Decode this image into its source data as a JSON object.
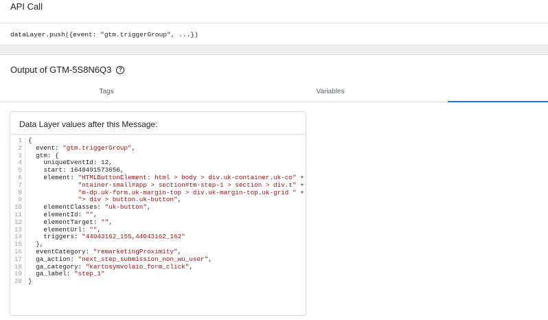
{
  "api_call": {
    "title": "API Call",
    "code": "dataLayer.push({event: \"gtm.triggerGroup\", ...})"
  },
  "output": {
    "title": "Output of GTM-5S8N6Q3",
    "tabs": [
      {
        "label": "Tags"
      },
      {
        "label": "Variables"
      },
      {
        "label": ""
      }
    ],
    "active_tab_index": 2
  },
  "data_layer": {
    "title": "Data Layer values after this Message:",
    "lines": [
      {
        "num": "1",
        "segments": [
          {
            "t": "{",
            "k": "n"
          }
        ]
      },
      {
        "num": "2",
        "segments": [
          {
            "t": "  event: ",
            "k": "n"
          },
          {
            "t": "\"gtm.triggerGroup\"",
            "k": "s"
          },
          {
            "t": ",",
            "k": "n"
          }
        ]
      },
      {
        "num": "3",
        "segments": [
          {
            "t": "  gtm: {",
            "k": "n"
          }
        ]
      },
      {
        "num": "4",
        "segments": [
          {
            "t": "    uniqueEventId: 12,",
            "k": "n"
          }
        ]
      },
      {
        "num": "5",
        "segments": [
          {
            "t": "    start: 1648491573656,",
            "k": "n"
          }
        ]
      },
      {
        "num": "6",
        "segments": [
          {
            "t": "    element: ",
            "k": "n"
          },
          {
            "t": "\"HTMLButtonElement: html > body > div.uk-container.uk-co\"",
            "k": "s"
          },
          {
            "t": " +",
            "k": "n"
          }
        ]
      },
      {
        "num": "7",
        "segments": [
          {
            "t": "             ",
            "k": "n"
          },
          {
            "t": "\"ntainer-small#app > section#tm-step-1 > section > div.t\"",
            "k": "s"
          },
          {
            "t": " +",
            "k": "n"
          }
        ]
      },
      {
        "num": "8",
        "segments": [
          {
            "t": "             ",
            "k": "n"
          },
          {
            "t": "\"m-dp.uk-form.uk-margin-top > div.uk-margin-top.uk-grid \"",
            "k": "s"
          },
          {
            "t": " +",
            "k": "n"
          }
        ]
      },
      {
        "num": "9",
        "segments": [
          {
            "t": "             ",
            "k": "n"
          },
          {
            "t": "\"> div > button.uk-button\"",
            "k": "s"
          },
          {
            "t": ",",
            "k": "n"
          }
        ]
      },
      {
        "num": "10",
        "segments": [
          {
            "t": "    elementClasses: ",
            "k": "n"
          },
          {
            "t": "\"uk-button\"",
            "k": "s"
          },
          {
            "t": ",",
            "k": "n"
          }
        ]
      },
      {
        "num": "11",
        "segments": [
          {
            "t": "    elementId: ",
            "k": "n"
          },
          {
            "t": "\"\"",
            "k": "s"
          },
          {
            "t": ",",
            "k": "n"
          }
        ]
      },
      {
        "num": "12",
        "segments": [
          {
            "t": "    elementTarget: ",
            "k": "n"
          },
          {
            "t": "\"\"",
            "k": "s"
          },
          {
            "t": ",",
            "k": "n"
          }
        ]
      },
      {
        "num": "13",
        "segments": [
          {
            "t": "    elementUrl: ",
            "k": "n"
          },
          {
            "t": "\"\"",
            "k": "s"
          },
          {
            "t": ",",
            "k": "n"
          }
        ]
      },
      {
        "num": "14",
        "segments": [
          {
            "t": "    triggers: ",
            "k": "n"
          },
          {
            "t": "\"44043162_155,44043162_162\"",
            "k": "s"
          }
        ]
      },
      {
        "num": "15",
        "segments": [
          {
            "t": "  },",
            "k": "n"
          }
        ]
      },
      {
        "num": "16",
        "segments": [
          {
            "t": "  eventCategory: ",
            "k": "n"
          },
          {
            "t": "\"remarketingProximity\"",
            "k": "s"
          },
          {
            "t": ",",
            "k": "n"
          }
        ]
      },
      {
        "num": "17",
        "segments": [
          {
            "t": "  ga_action: ",
            "k": "n"
          },
          {
            "t": "\"next_step_submission_non_wu_user\"",
            "k": "s"
          },
          {
            "t": ",",
            "k": "n"
          }
        ]
      },
      {
        "num": "18",
        "segments": [
          {
            "t": "  ga_category: ",
            "k": "n"
          },
          {
            "t": "\"kartosymvolaio_form_click\"",
            "k": "s"
          },
          {
            "t": ",",
            "k": "n"
          }
        ]
      },
      {
        "num": "19",
        "segments": [
          {
            "t": "  ga_label: ",
            "k": "n"
          },
          {
            "t": "\"step_1\"",
            "k": "s"
          }
        ]
      },
      {
        "num": "20",
        "segments": [
          {
            "t": "}",
            "k": "n"
          }
        ]
      }
    ]
  },
  "colors": {
    "string": "#a31515",
    "accent": "#1a73e8",
    "line_number": "#9aa0a6"
  },
  "icons": {
    "help": "help-circle-icon"
  }
}
